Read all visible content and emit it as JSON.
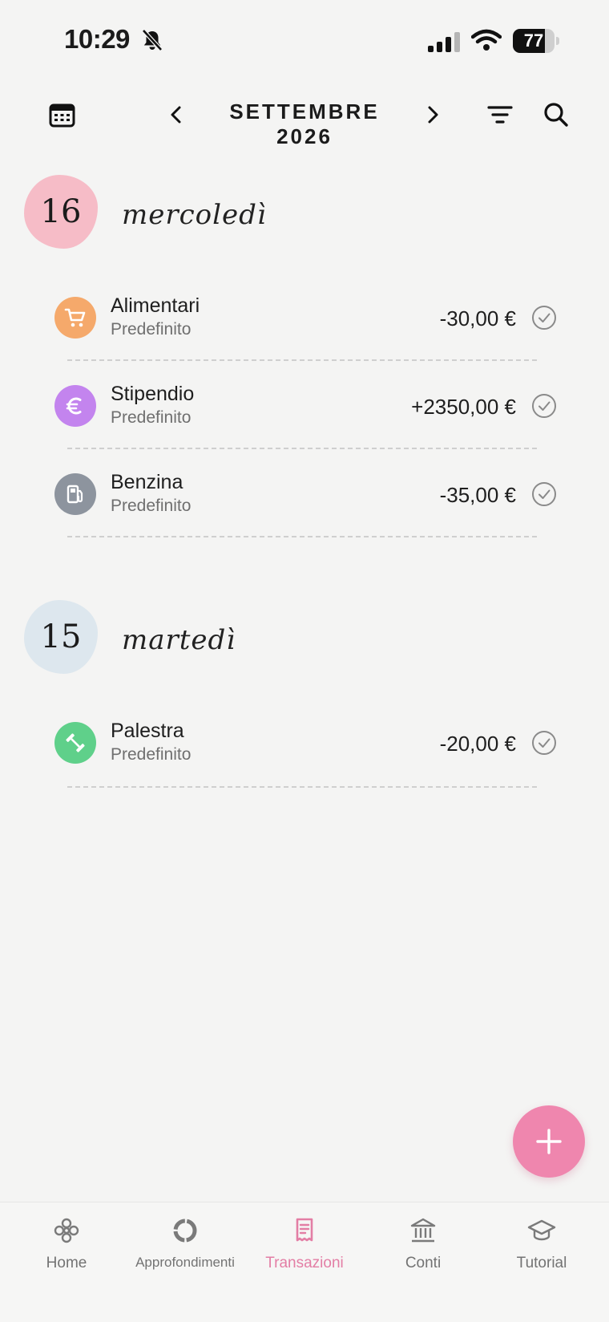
{
  "status_bar": {
    "time": "10:29",
    "battery": "77",
    "battery_level": 0.77
  },
  "header": {
    "month_title": "SETTEMBRE 2026"
  },
  "colors": {
    "accent": "#ef86ae",
    "day_16_blob": "#f6bcc7",
    "day_15_blob": "#dde7ee",
    "groceries": "#f5a96b",
    "salary": "#c384ee",
    "fuel": "#8d949e",
    "gym": "#5fd08a"
  },
  "days": [
    {
      "day_number": "16",
      "weekday": "mercoledì",
      "transactions": [
        {
          "title": "Alimentari",
          "account": "Predefinito",
          "amount": "-30,00 €",
          "icon": "cart-icon"
        },
        {
          "title": "Stipendio",
          "account": "Predefinito",
          "amount": "+2350,00 €",
          "icon": "euro-icon"
        },
        {
          "title": "Benzina",
          "account": "Predefinito",
          "amount": "-35,00 €",
          "icon": "fuel-pump-icon"
        }
      ]
    },
    {
      "day_number": "15",
      "weekday": "martedì",
      "transactions": [
        {
          "title": "Palestra",
          "account": "Predefinito",
          "amount": "-20,00 €",
          "icon": "dumbbell-icon"
        }
      ]
    }
  ],
  "tabs": [
    {
      "label": "Home",
      "icon": "flower-icon"
    },
    {
      "label": "Approfondimenti",
      "icon": "donut-chart-icon"
    },
    {
      "label": "Transazioni",
      "icon": "receipt-icon",
      "active": true
    },
    {
      "label": "Conti",
      "icon": "bank-icon"
    },
    {
      "label": "Tutorial",
      "icon": "graduation-cap-icon"
    }
  ]
}
